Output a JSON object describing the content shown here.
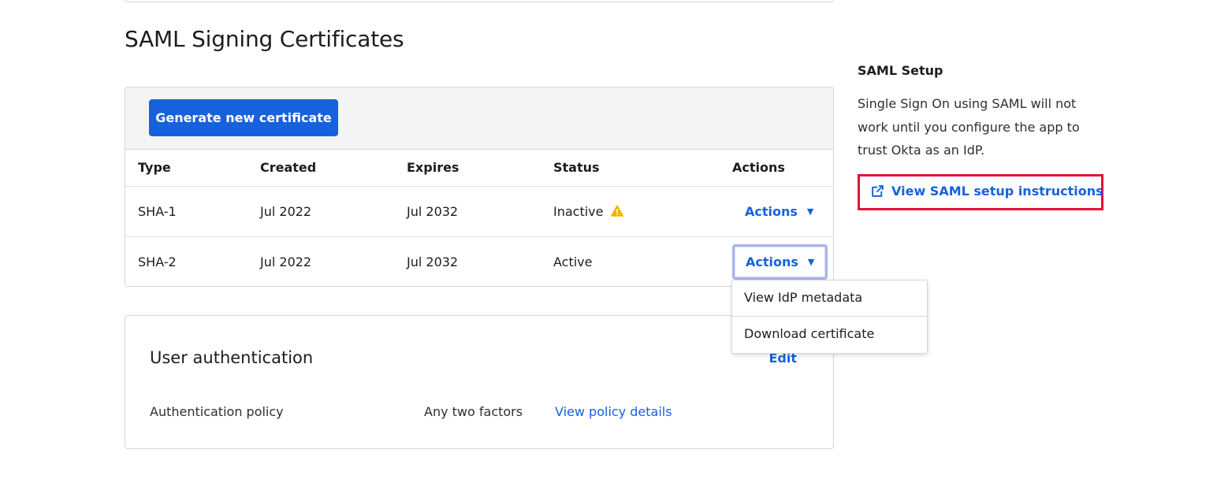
{
  "page": {
    "title": "SAML Signing Certificates"
  },
  "certificates": {
    "generate_label": "Generate new certificate",
    "columns": [
      "Type",
      "Created",
      "Expires",
      "Status",
      "Actions"
    ],
    "rows": [
      {
        "type": "SHA-1",
        "created": "Jul 2022",
        "expires": "Jul 2032",
        "status": "Inactive",
        "status_icon": "warning-icon",
        "actions_label": "Actions"
      },
      {
        "type": "SHA-2",
        "created": "Jul 2022",
        "expires": "Jul 2032",
        "status": "Active",
        "actions_label": "Actions"
      }
    ],
    "dropdown": {
      "items": [
        "View IdP metadata",
        "Download certificate"
      ]
    }
  },
  "user_auth": {
    "title": "User authentication",
    "edit_label": "Edit",
    "policy_label": "Authentication policy",
    "policy_value": "Any two factors",
    "policy_link": "View policy details"
  },
  "saml_setup": {
    "title": "SAML Setup",
    "description": "Single Sign On using SAML will not work until you configure the app to trust Okta as an IdP.",
    "link_label": "View SAML setup instructions",
    "link_icon": "external-link-icon"
  },
  "colors": {
    "primary": "#1662dd",
    "highlight_border": "#e3103c",
    "warning": "#f0b400"
  }
}
